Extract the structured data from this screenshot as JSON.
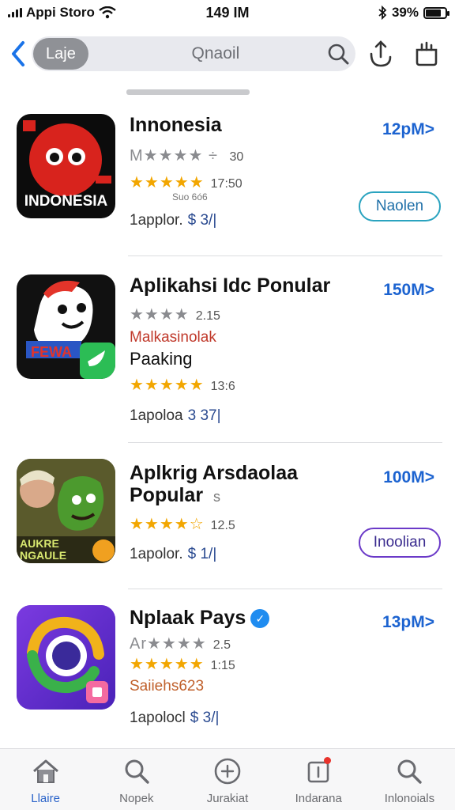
{
  "status_bar": {
    "carrier": "Appi Storo",
    "time": "149 IM",
    "battery": "39%",
    "battery_level": 0.8
  },
  "nav": {
    "lang_chip": "Laje",
    "search_text": "Qnaoil"
  },
  "apps": [
    {
      "name": "Innonesia",
      "name_red_letter": "a",
      "icon_text": "INDONESIA",
      "size": "12pM>",
      "grey_rating_text": "M",
      "grey_rating_value": "30",
      "gold_rating_count": "17:50",
      "sub_small": "Suo 6ó6",
      "price_label": "1applor.",
      "price": "$ 3/|",
      "button": "Naolen"
    },
    {
      "name": "Aplikahsi Idc Ponular",
      "icon_text": "FEWA",
      "size": "150M>",
      "grey_rating_value": "2.15",
      "sub_red": "Malkasinolak",
      "sub_plain": "Paaking",
      "gold_rating_count": "13:6",
      "price_label": "1apoloa",
      "price": "3 37|"
    },
    {
      "name_line1": "Aplkrig Arsdaolaa",
      "name_line2": "Popular",
      "name_line2_suffix": "s",
      "icon_text": "AUKRE NGAULE",
      "size": "100M>",
      "gold_rating_count": "12.5",
      "price_label": "1apolor.",
      "price": "$ 1/|",
      "button": "Inoolian"
    },
    {
      "name": "Nplaak Pays",
      "size": "13pM>",
      "grey_rating_text": "Ar",
      "grey_rating_value": "2.5",
      "gold_rating_count": "1:15",
      "sub_red": "Saiiehs623",
      "price_label": "1apolocl",
      "price": "$ 3/|"
    }
  ],
  "tabs": [
    {
      "label": "Llaire",
      "icon": "home-icon"
    },
    {
      "label": "Nopek",
      "icon": "search-icon"
    },
    {
      "label": "Jurakiat",
      "icon": "compass-icon"
    },
    {
      "label": "Indarana",
      "icon": "updates-icon"
    },
    {
      "label": "Inlonoials",
      "icon": "search-icon"
    }
  ],
  "colors": {
    "accent": "#1c63d0",
    "star_gold": "#f2a600",
    "button_teal": "#2aa3bf",
    "button_purple": "#6b3ac8"
  }
}
